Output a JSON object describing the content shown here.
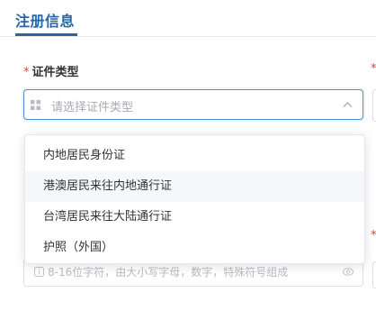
{
  "section": {
    "tab_title": "注册信息"
  },
  "id_type_field": {
    "required_mark": "*",
    "label": "证件类型",
    "placeholder": "请选择证件类型",
    "options": [
      "内地居民身份证",
      "港澳居民来往内地通行证",
      "台湾居民来往大陆通行证",
      "护照（外国）"
    ],
    "hovered_option_index": 1
  },
  "password_field": {
    "hint": "8-16位字符，由大小写字母，数字，特殊符号组成"
  },
  "icons": {
    "select_prefix": "grid-icon",
    "select_suffix": "chevron-up-icon",
    "password_prefix": "info-icon",
    "password_suffix": "eye-icon"
  },
  "colors": {
    "accent": "#2566a8",
    "focus_border": "#4c8fd6",
    "required": "#e0433a",
    "placeholder": "#a8abb2",
    "hover_bg": "#f5f7fa"
  }
}
